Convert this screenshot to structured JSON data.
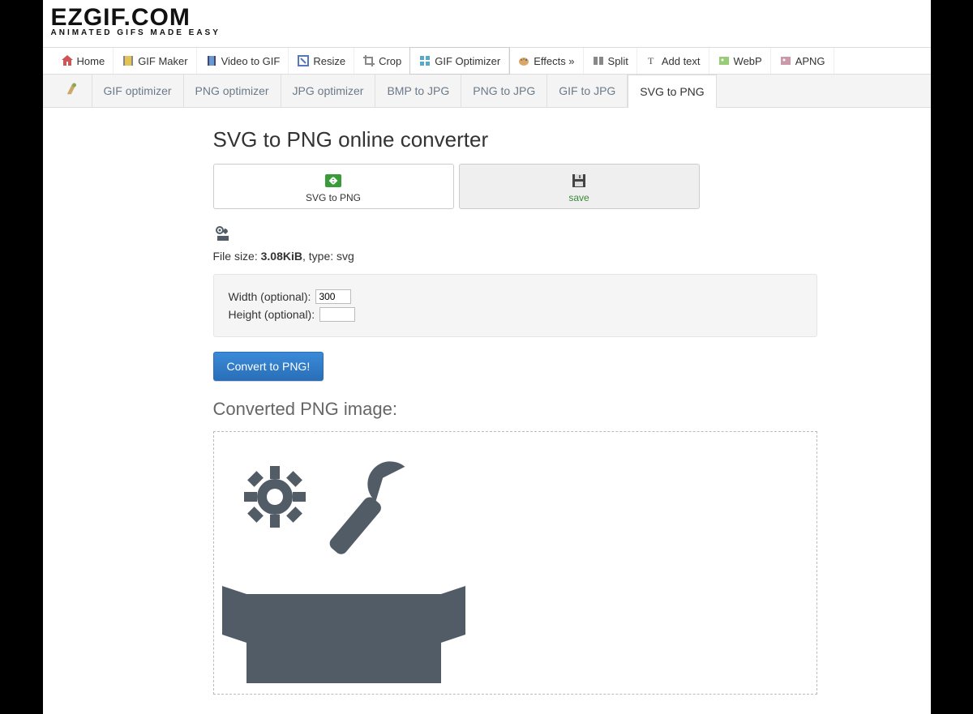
{
  "logo": {
    "main": "EZGIF.COM",
    "sub": "ANIMATED GIFS MADE EASY"
  },
  "nav_primary": {
    "home": "Home",
    "gif_maker": "GIF Maker",
    "video_to_gif": "Video to GIF",
    "resize": "Resize",
    "crop": "Crop",
    "gif_optimizer": "GIF Optimizer",
    "effects": "Effects »",
    "split": "Split",
    "add_text": "Add text",
    "webp": "WebP",
    "apng": "APNG"
  },
  "nav_secondary": {
    "gif_opt": "GIF optimizer",
    "png_opt": "PNG optimizer",
    "jpg_opt": "JPG optimizer",
    "bmp_jpg": "BMP to JPG",
    "png_jpg": "PNG to JPG",
    "gif_jpg": "GIF to JPG",
    "svg_png": "SVG to PNG"
  },
  "page_title": "SVG to PNG online converter",
  "actions": {
    "svg_to_png": "SVG to PNG",
    "save": "save"
  },
  "file_info": {
    "label": "File size: ",
    "size": "3.08KiB",
    "type_label": ", type: ",
    "type": "svg"
  },
  "form": {
    "width_label": "Width (optional):",
    "height_label": "Height (optional):",
    "width_value": "300",
    "height_value": ""
  },
  "convert_button": "Convert to PNG!",
  "result_title": "Converted PNG image:",
  "preview_color": "#525c66"
}
